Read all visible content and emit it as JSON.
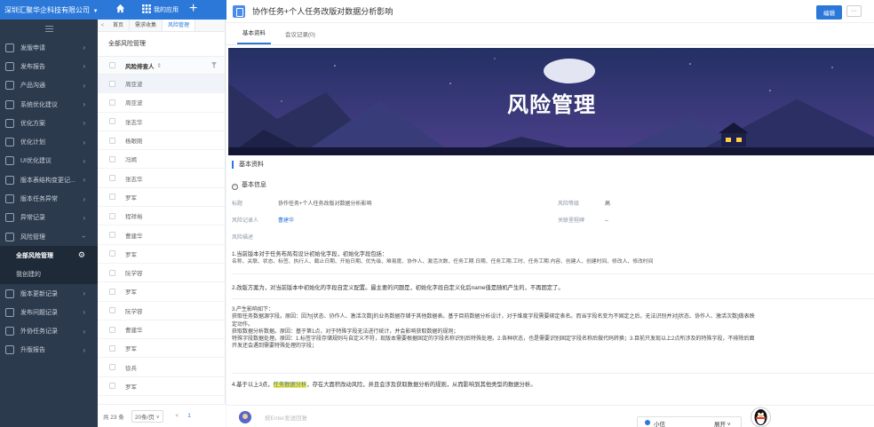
{
  "topbar": {
    "company": "深圳汇聚华企科技有限公司",
    "my_apps": "我的应用"
  },
  "sidebar": {
    "items": [
      {
        "label": "发版申请"
      },
      {
        "label": "发布报告"
      },
      {
        "label": "产品沟通"
      },
      {
        "label": "系统优化建议"
      },
      {
        "label": "优化方案"
      },
      {
        "label": "优化计划"
      },
      {
        "label": "UI优化建议"
      },
      {
        "label": "版本表结构变更记..."
      },
      {
        "label": "版本任务异常"
      },
      {
        "label": "异常记录"
      },
      {
        "label": "风险管理"
      }
    ],
    "sub_items": [
      {
        "label": "全部风险管理"
      },
      {
        "label": "我创建的"
      }
    ],
    "items_after": [
      {
        "label": "版本更新记录"
      },
      {
        "label": "发布问题记录"
      },
      {
        "label": "外协任务记录"
      },
      {
        "label": "升版报告"
      }
    ]
  },
  "tabs": {
    "items": [
      {
        "label": "首页"
      },
      {
        "label": "需求收集"
      },
      {
        "label": "风险管理"
      }
    ]
  },
  "list": {
    "title": "全部风险管理",
    "column": "风险排查人",
    "rows": [
      "周亚波",
      "周亚波",
      "张志华",
      "杨眼刚",
      "冯嫣",
      "张志华",
      "罗军",
      "程祥裕",
      "曹建华",
      "罗军",
      "阮学容",
      "罗军",
      "阮学容",
      "曹建华",
      "罗军",
      "徐兵",
      "罗军"
    ],
    "pager": {
      "total": "共 23 条",
      "per_page": "20条/页",
      "prev": "<",
      "page": "1"
    }
  },
  "detail": {
    "title": "协作任务+个人任务改版对数据分析影响",
    "edit": "编辑",
    "more": "···",
    "tabs": [
      {
        "label": "基本资料"
      },
      {
        "label": "会议记录(0)"
      }
    ],
    "banner_title": "风险管理",
    "section": "基本资料",
    "basic_info": "基本信息",
    "fields": {
      "title_k": "标题",
      "title_v": "协作任务+个人任务改版对数据分析影响",
      "level_k": "风险等级",
      "level_v": "高",
      "recorder_k": "风险记录人",
      "recorder_v": "曹建华",
      "related_k": "关联里程碑",
      "related_v": "--",
      "desc_k": "风险描述"
    },
    "desc": {
      "p1a": "1.当前版本对于任务布局有设计初始化字段，初始化字段包括：",
      "p1b": "名称、关联、状态、标签、执行人、截止日期、开始日期、优先级、难易度、协作人、激活次数、任务工期.日期、任务工期.工时、任务工期.内容、创建人、创建时间、修改人、修改时间",
      "p2": "2.改版方案为，对当前版本中初始化的字段自定义配置。最主要的问题是，初始化字段自定义化后name值是随机产生的，不再固定了。",
      "p3a": "3.产生影响如下：",
      "p3b": "获取任务数据源字段。原因：因为[状态、协作人、激活次数]的业务数据存储于其他数据表。基于目前数据分析设计，对于维度字段需要绑定表名。而当字段名变为不固定之后，无法识别并对[状态、协作人、激活次数]做表映",
      "p3c": "定动作。",
      "p3d": "获取数据分析数据。原因：基于第1点，对于特殊字段无法进行统计，并会影响获取数据的规则；",
      "p3e": "特殊字段数据处理。原因：1.标签字段存储规则与自定义不符，现版本需要根据固定的字段名称识别后特殊处理。2.各种状态，也是需要识别固定字段名称后做代码转换；3.目前只发现以上2点所涉及的特殊字段，不排除后面",
      "p3f": "开发还会遇到需要特殊处理的字段；",
      "p4a": "4.基于以上3点，",
      "p4hl": "任务数据分析",
      "p4b": "，存在大面积改动风险，并且会涉及获取数据分析的规则，从而影响到其他类型的数据分析。"
    },
    "input_placeholder": "按Enter发送回复",
    "chat": {
      "status": "小信",
      "expand": "展开 ˅"
    }
  }
}
